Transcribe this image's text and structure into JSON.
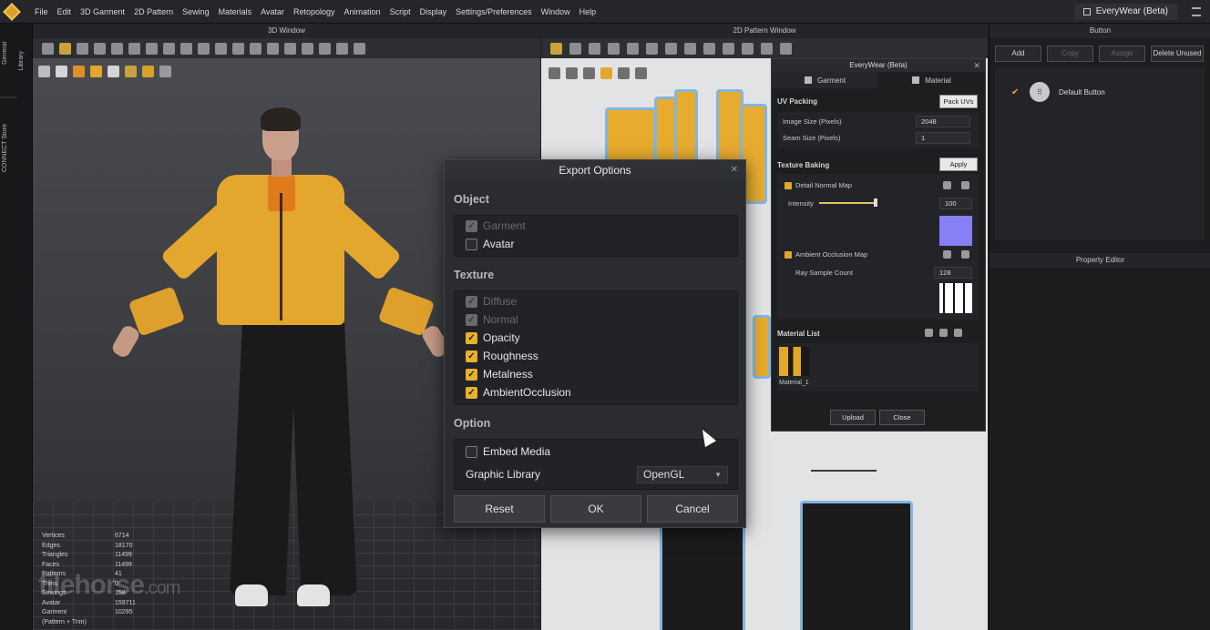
{
  "menubar": {
    "items": [
      "File",
      "Edit",
      "3D Garment",
      "2D Pattern",
      "Sewing",
      "Materials",
      "Avatar",
      "Retopology",
      "Animation",
      "Script",
      "Display",
      "Settings/Preferences",
      "Window",
      "Help"
    ],
    "product": "EveryWear (Beta)"
  },
  "left_rail": {
    "library": "Library",
    "general": "General",
    "connect": "CONNECT Store"
  },
  "window3d": {
    "title": "3D Window",
    "stats": [
      {
        "label": "Vertices",
        "value": "6714"
      },
      {
        "label": "Edges",
        "value": "18170"
      },
      {
        "label": "Triangles",
        "value": "11499"
      },
      {
        "label": "Faces",
        "value": "11499"
      },
      {
        "label": "Patterns",
        "value": "41"
      },
      {
        "label": "Trims",
        "value": "0"
      },
      {
        "label": "Sewings",
        "value": "158"
      },
      {
        "label": "Avatar",
        "value": "159711"
      },
      {
        "label": "Garment",
        "value": "10295"
      },
      {
        "label": "(Pattern + Trim)",
        "value": ""
      }
    ],
    "watermark": "filehorse",
    "watermark_suffix": ".com"
  },
  "window2d": {
    "title": "2D Pattern Window"
  },
  "button_panel": {
    "title": "Button",
    "add": "Add",
    "copy": "Copy",
    "assign": "Assign",
    "delete_unused": "Delete Unused",
    "item": "Default Button"
  },
  "property_editor": {
    "title": "Property Editor"
  },
  "everywear": {
    "title": "EveryWear (Beta)",
    "tab_garment": "Garment",
    "tab_material": "Material",
    "uv_packing": "UV Packing",
    "pack_uvs": "Pack UVs",
    "image_size_label": "Image Size (Pixels)",
    "image_size_value": "2048",
    "seam_size_label": "Seam Size (Pixels)",
    "seam_size_value": "1",
    "texture_baking": "Texture Baking",
    "apply": "Apply",
    "detail_normal_map": "Detail Normal Map",
    "intensity_label": "Intensity",
    "intensity_value": "100",
    "ambient_occlusion_map": "Ambient Occlusion Map",
    "ray_sample_label": "Ray Sample Count",
    "ray_sample_value": "128",
    "material_list": "Material List",
    "material_name": "Material_1",
    "upload": "Upload",
    "close": "Close"
  },
  "export_dialog": {
    "title": "Export Options",
    "object_section": "Object",
    "object_options": [
      {
        "label": "Garment",
        "checked": true,
        "disabled": true
      },
      {
        "label": "Avatar",
        "checked": false,
        "disabled": false
      }
    ],
    "texture_section": "Texture",
    "texture_options": [
      {
        "label": "Diffuse",
        "checked": true,
        "disabled": true
      },
      {
        "label": "Normal",
        "checked": true,
        "disabled": true
      },
      {
        "label": "Opacity",
        "checked": true,
        "disabled": false
      },
      {
        "label": "Roughness",
        "checked": true,
        "disabled": false
      },
      {
        "label": "Metalness",
        "checked": true,
        "disabled": false
      },
      {
        "label": "AmbientOcclusion",
        "checked": true,
        "disabled": false
      }
    ],
    "option_section": "Option",
    "embed_media": "Embed Media",
    "embed_media_checked": false,
    "graphic_library_label": "Graphic Library",
    "graphic_library_value": "OpenGL",
    "reset": "Reset",
    "ok": "OK",
    "cancel": "Cancel"
  },
  "colors": {
    "accent": "#e8b22a",
    "garment": "#e3a72d",
    "normal_map": "#8580f6"
  }
}
